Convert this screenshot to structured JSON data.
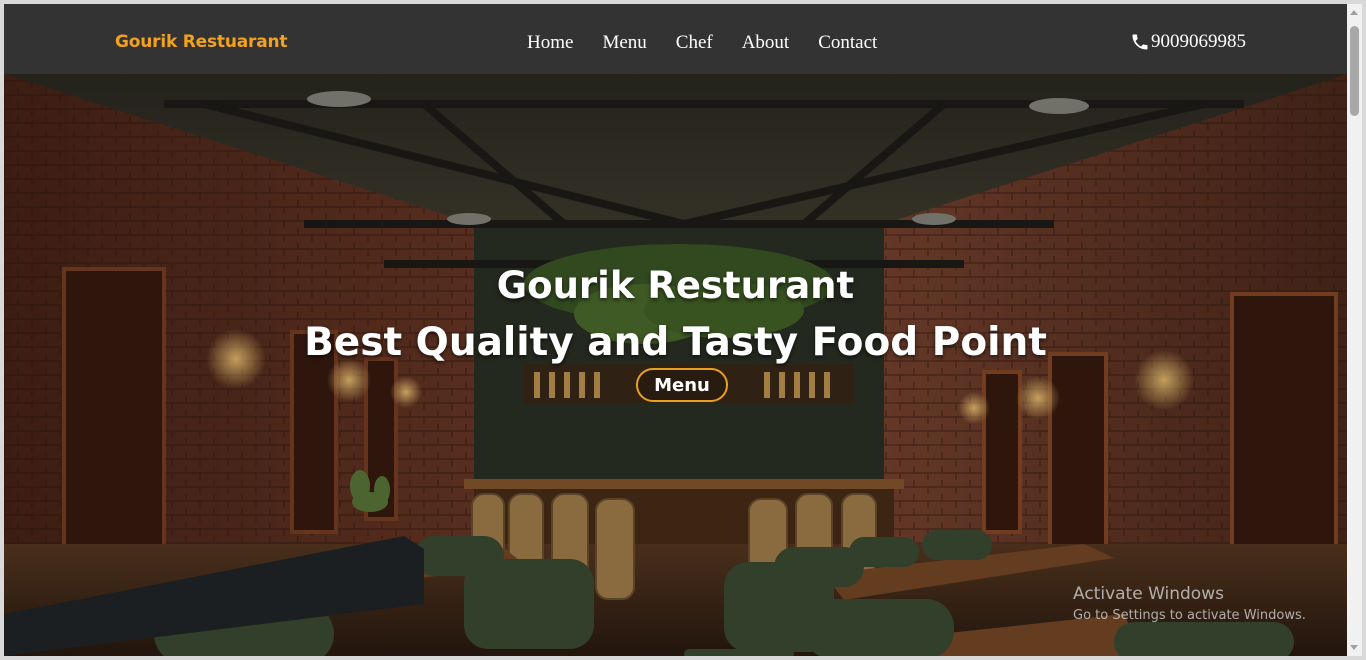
{
  "navbar": {
    "brand": "Gourik Restuarant",
    "links": [
      "Home",
      "Menu",
      "Chef",
      "About",
      "Contact"
    ],
    "phone": "9009069985",
    "phone_icon": "phone-icon"
  },
  "hero": {
    "title": "Gourik Resturant",
    "subtitle": "Best Quality and Tasty Food Point",
    "button_label": "Menu",
    "background": "restaurant-interior-photo"
  },
  "watermark": {
    "title": "Activate Windows",
    "subtitle": "Go to Settings to activate Windows."
  },
  "colors": {
    "navbar_bg": "#333333",
    "brand": "#f3a21e",
    "button_border": "#e8a020",
    "text": "#ffffff"
  }
}
